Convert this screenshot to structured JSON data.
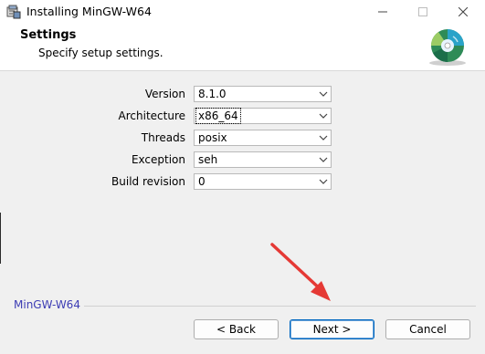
{
  "window": {
    "title": "Installing MinGW-W64",
    "icons": [
      "installer-app-icon",
      "minimize-icon",
      "maximize-icon",
      "close-icon"
    ]
  },
  "header": {
    "title": "Settings",
    "subtitle": "Specify setup settings.",
    "icon": "cd-disc-icon"
  },
  "settings": {
    "version": {
      "label": "Version",
      "value": "8.1.0"
    },
    "architecture": {
      "label": "Architecture",
      "value": "x86_64"
    },
    "threads": {
      "label": "Threads",
      "value": "posix"
    },
    "exception": {
      "label": "Exception",
      "value": "seh"
    },
    "build_revision": {
      "label": "Build revision",
      "value": "0"
    }
  },
  "footer": {
    "brand": "MinGW-W64",
    "back_label": "< Back",
    "next_label": "Next >",
    "cancel_label": "Cancel"
  },
  "colors": {
    "brand_text": "#3c3cb4",
    "annotation_arrow": "#e53935",
    "focus_border": "#0067c0"
  }
}
